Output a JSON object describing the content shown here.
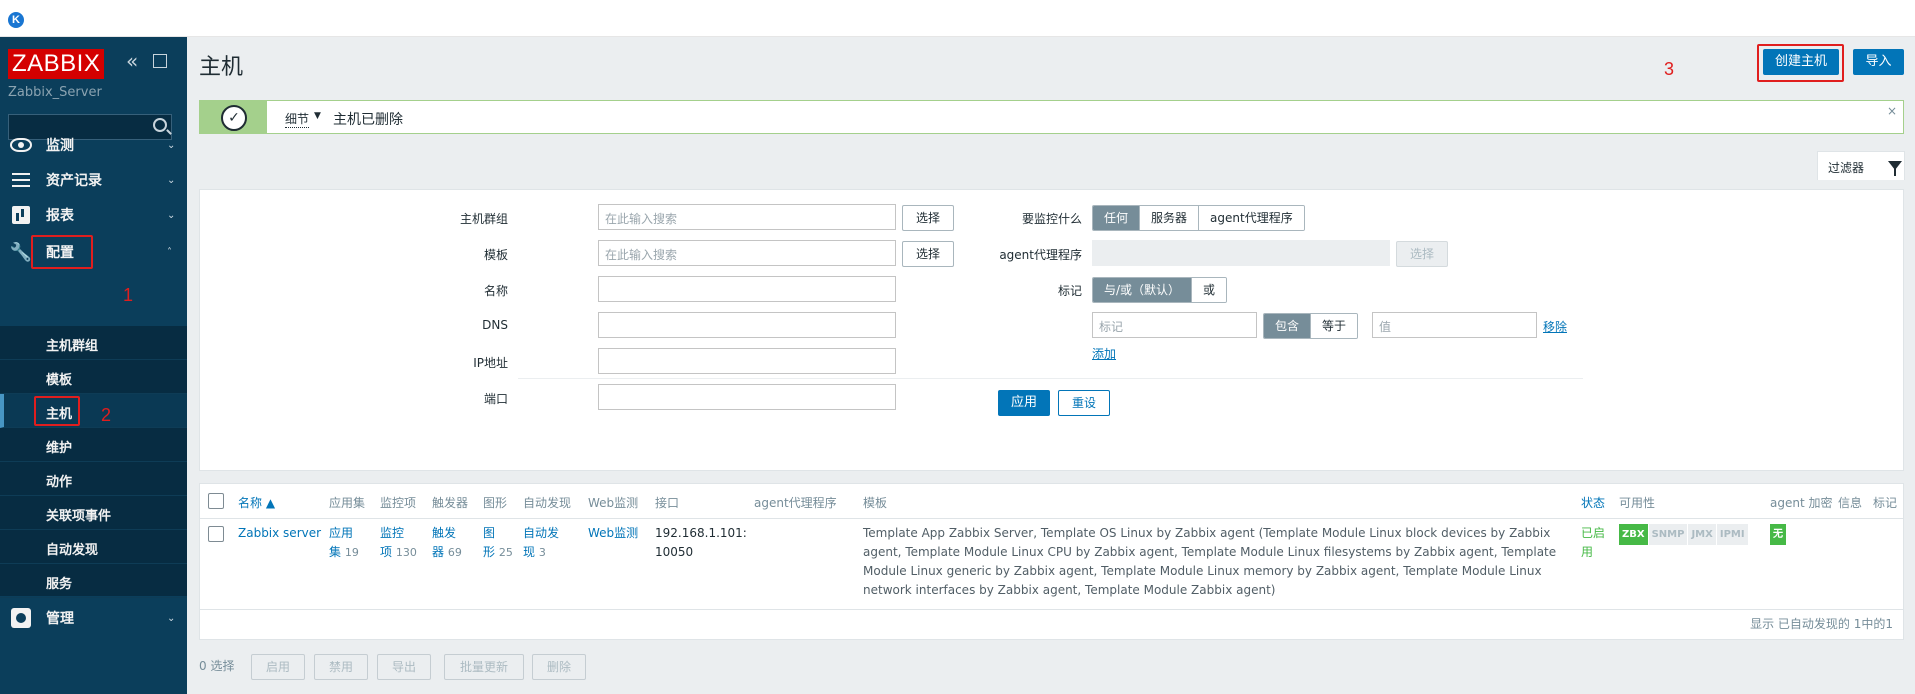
{
  "browser": {
    "tab_icon": "K"
  },
  "sidebar": {
    "logo": "ZABBIX",
    "server": "Zabbix_Server",
    "menu": [
      {
        "label": "监测",
        "icon": "eye-icon"
      },
      {
        "label": "资产记录",
        "icon": "list-icon"
      },
      {
        "label": "报表",
        "icon": "bar-chart-icon"
      },
      {
        "label": "配置",
        "icon": "wrench-icon"
      },
      {
        "label": "管理",
        "icon": "gear-icon"
      }
    ],
    "submenu": [
      "主机群组",
      "模板",
      "主机",
      "维护",
      "动作",
      "关联项事件",
      "自动发现",
      "服务"
    ]
  },
  "annotations": {
    "n1": "1",
    "n2": "2",
    "n3": "3"
  },
  "header": {
    "title": "主机",
    "create_host": "创建主机",
    "import": "导入"
  },
  "message": {
    "details": "细节",
    "text": "主机已删除"
  },
  "filter": {
    "tab": "过滤器",
    "host_groups_label": "主机群组",
    "templates_label": "模板",
    "name_label": "名称",
    "dns_label": "DNS",
    "ip_label": "IP地址",
    "port_label": "端口",
    "search_placeholder": "在此输入搜索",
    "select": "选择",
    "monitored_by_label": "要监控什么",
    "monitored_by": [
      "任何",
      "服务器",
      "agent代理程序"
    ],
    "proxy_label": "agent代理程序",
    "tags_label": "标记",
    "tag_mode": [
      "与/或（默认）",
      "或"
    ],
    "tag_placeholder": "标记",
    "tag_ops": [
      "包含",
      "等于"
    ],
    "value_placeholder": "值",
    "remove": "移除",
    "add": "添加",
    "apply": "应用",
    "reset": "重设"
  },
  "table": {
    "headers": {
      "name": "名称 ▲",
      "apps": "应用集",
      "items": "监控项",
      "triggers": "触发器",
      "graphs": "图形",
      "discovery": "自动发现",
      "web": "Web监测",
      "interface": "接口",
      "proxy": "agent代理程序",
      "templates": "模板",
      "status": "状态",
      "availability": "可用性",
      "encryption": "agent 加密",
      "info": "信息",
      "tags": "标记"
    },
    "row": {
      "name": "Zabbix server",
      "apps": "应用",
      "apps2": "集",
      "apps_count": "19",
      "items": "监控",
      "items2": "项",
      "items_count": "130",
      "triggers": "触发",
      "triggers2": "器",
      "triggers_count": "69",
      "graphs": "图",
      "graphs2": "形",
      "graphs_count": "25",
      "discovery": "自动发",
      "discovery2": "现",
      "discovery_count": "3",
      "web": "Web监测",
      "interface1": "192.168.1.101:",
      "interface2": "10050",
      "tpl_a": "Template App Zabbix Server",
      "tpl_b": "Template OS Linux by Zabbix agent",
      "tpl_c": "Template Module Linux block devices by Zabbix agent",
      "tpl_d": "Template Module Linux CPU by Zabbix agent",
      "tpl_e": "Template Module Linux filesystems by Zabbix agent",
      "tpl_f": "Template Module Linux generic by Zabbix agent",
      "tpl_g": "Template Module Linux memory by Zabbix agent",
      "tpl_h": "Template Module Linux network interfaces by Zabbix agent",
      "tpl_i": "Template Module Zabbix agent",
      "status1": "已启",
      "status2": "用",
      "zbx": "ZBX",
      "snmp": "SNMP",
      "jmx": "JMX",
      "ipmi": "IPMI",
      "encryption": "无"
    },
    "summary": "显示 已自动发现的 1中的1"
  },
  "footer": {
    "selected": "0 选择",
    "buttons": [
      "启用",
      "禁用",
      "导出",
      "批量更新",
      "删除"
    ]
  }
}
